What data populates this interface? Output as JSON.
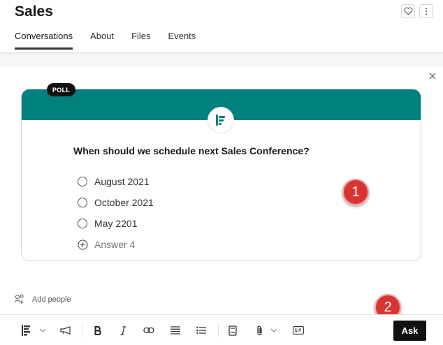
{
  "header": {
    "title": "Sales",
    "tabs": [
      {
        "label": "Conversations",
        "active": true
      },
      {
        "label": "About",
        "active": false
      },
      {
        "label": "Files",
        "active": false
      },
      {
        "label": "Events",
        "active": false
      }
    ]
  },
  "poll": {
    "badge": "POLL",
    "question": "When should we schedule next Sales Conference?",
    "options": [
      "August 2021",
      "October 2021",
      "May 2201"
    ],
    "add_option": "Answer 4",
    "band_color": "#00807f"
  },
  "callouts": [
    "1",
    "2"
  ],
  "add_people": "Add people",
  "composer": {
    "ask_label": "Ask",
    "icons": [
      "poll-icon",
      "chevron-down-icon",
      "announcement-icon",
      "bold-icon",
      "italic-icon",
      "link-icon",
      "bulleted-list-icon",
      "numbered-list-icon",
      "notebook-icon",
      "attach-icon",
      "gif-icon"
    ]
  }
}
